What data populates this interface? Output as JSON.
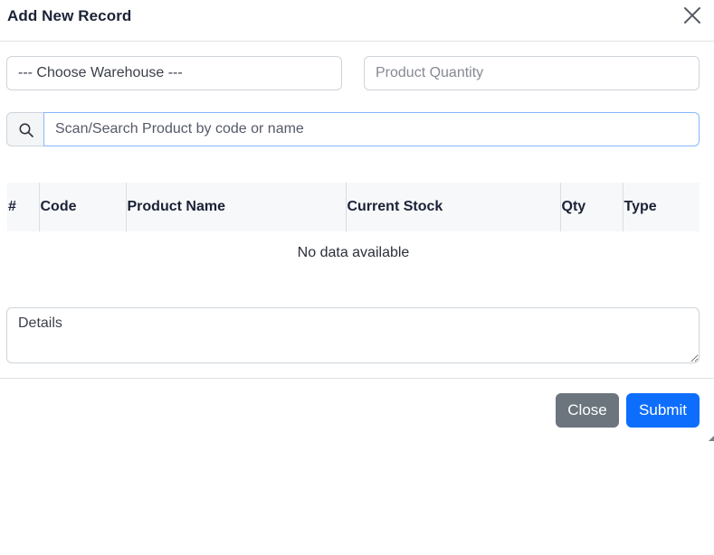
{
  "header": {
    "title": "Add New Record"
  },
  "form": {
    "warehouse_selected": "--- Choose Warehouse ---",
    "quantity_placeholder": "Product Quantity",
    "search_placeholder": "Scan/Search Product by code or name",
    "details_placeholder": "Details"
  },
  "table": {
    "columns": [
      "#",
      "Code",
      "Product Name",
      "Current Stock",
      "Qty",
      "Type"
    ],
    "empty_text": "No data available"
  },
  "footer": {
    "close_label": "Close",
    "submit_label": "Submit"
  },
  "icons": {
    "close": "close-icon",
    "search": "search-icon"
  },
  "colors": {
    "primary": "#0d6efd",
    "secondary": "#6c757d",
    "focus_border": "#86b7fe"
  }
}
